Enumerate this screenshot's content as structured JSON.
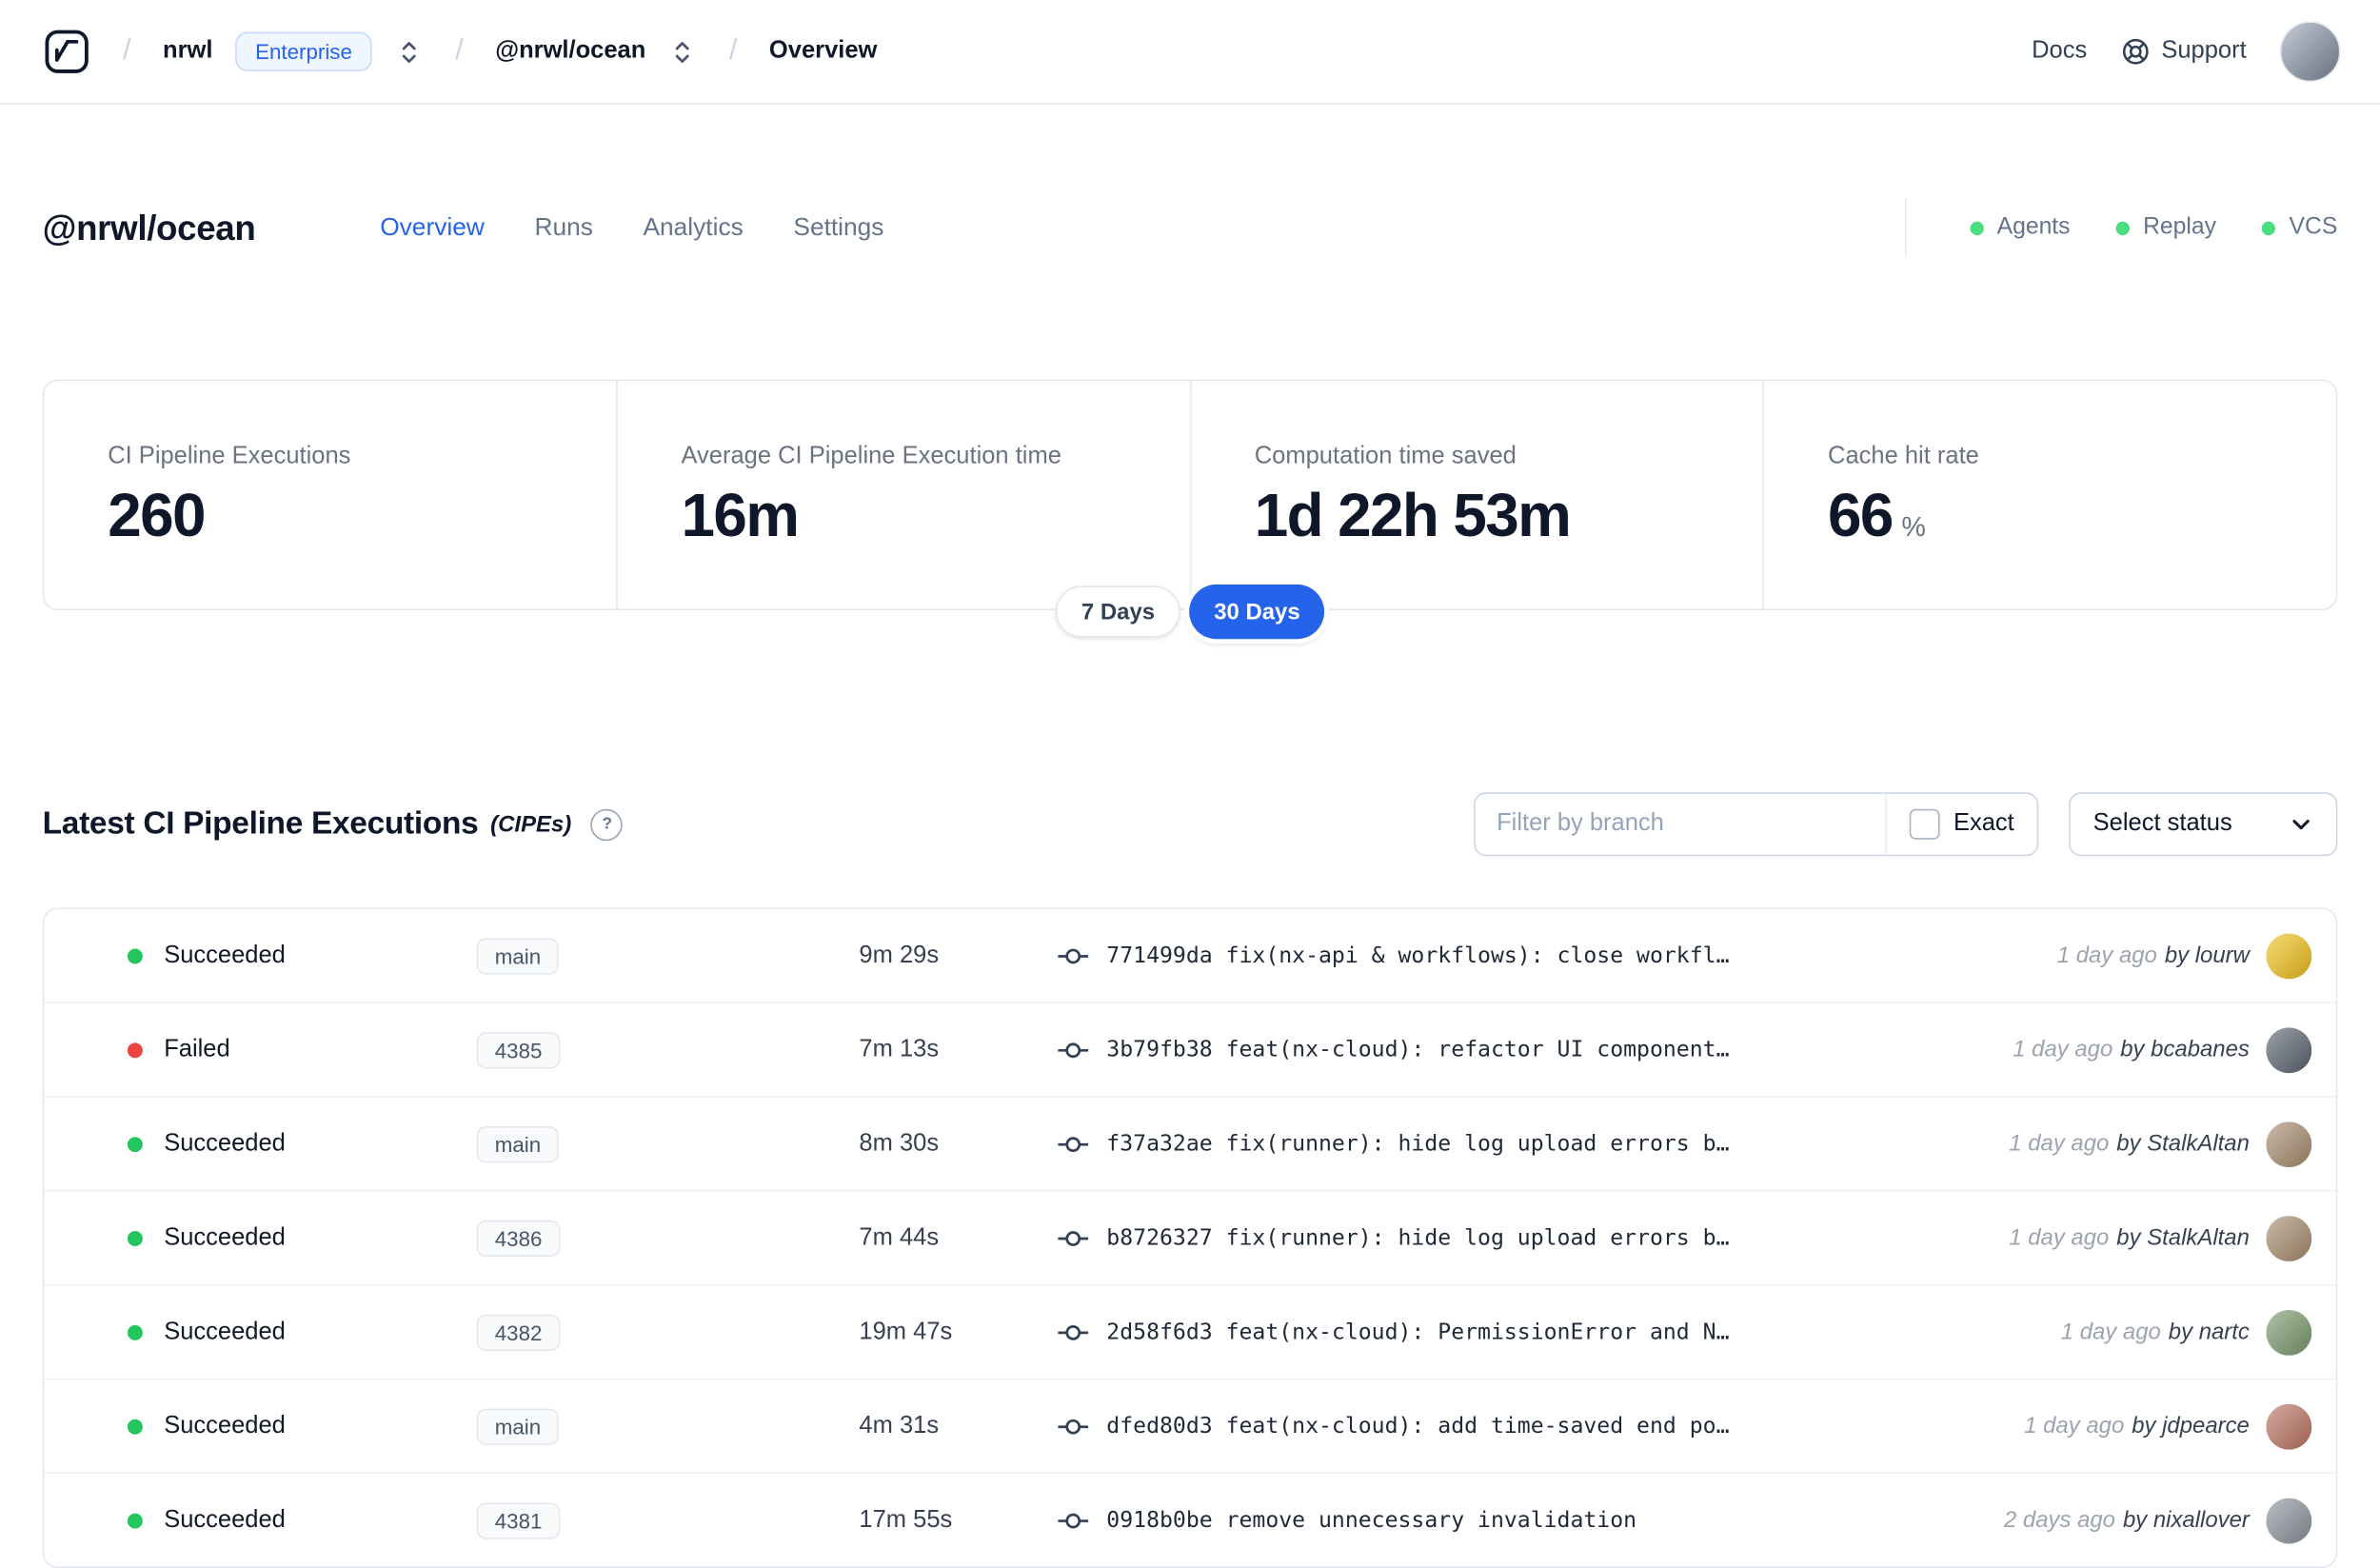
{
  "colors": {
    "accent": "#2563eb",
    "success": "#22c55e",
    "failure": "#ef4444",
    "indicator": "#4ade80"
  },
  "header": {
    "separator": "/",
    "org": "nrwl",
    "org_badge": "Enterprise",
    "workspace": "@nrwl/ocean",
    "page": "Overview",
    "docs": "Docs",
    "support": "Support"
  },
  "workspace_header": {
    "title": "@nrwl/ocean",
    "tabs": [
      {
        "label": "Overview"
      },
      {
        "label": "Runs"
      },
      {
        "label": "Analytics"
      },
      {
        "label": "Settings"
      }
    ],
    "indicators": [
      {
        "label": "Agents"
      },
      {
        "label": "Replay"
      },
      {
        "label": "VCS"
      }
    ]
  },
  "stats": {
    "cards": [
      {
        "label": "CI Pipeline Executions",
        "value": "260"
      },
      {
        "label": "Average CI Pipeline Execution time",
        "value": "16m"
      },
      {
        "label": "Computation time saved",
        "value": "1d 22h 53m"
      },
      {
        "label": "Cache hit rate",
        "value": "66",
        "suffix": "%"
      }
    ],
    "range_toggle": [
      {
        "label": "7 Days"
      },
      {
        "label": "30 Days"
      }
    ],
    "active_range": "30 Days"
  },
  "cipes": {
    "title": "Latest CI Pipeline Executions",
    "title_suffix": "(CIPEs)",
    "help_glyph": "?",
    "filter_placeholder": "Filter by branch",
    "exact_label": "Exact",
    "status_select": "Select status",
    "rows": [
      {
        "status": "Succeeded",
        "color": "green",
        "branch": "main",
        "duration": "9m 29s",
        "commit": "771499da fix(nx-api & workflows): close workfl…",
        "time": "1 day ago",
        "author": "by lourw",
        "avatar_color": "#f2c21b"
      },
      {
        "status": "Failed",
        "color": "red",
        "branch": "4385",
        "duration": "7m 13s",
        "commit": "3b79fb38 feat(nx-cloud): refactor UI component…",
        "time": "1 day ago",
        "author": "by bcabanes",
        "avatar_color": "#5b6472"
      },
      {
        "status": "Succeeded",
        "color": "green",
        "branch": "main",
        "duration": "8m 30s",
        "commit": "f37a32ae fix(runner): hide log upload errors b…",
        "time": "1 day ago",
        "author": "by StalkAltan",
        "avatar_color": "#a98d6f"
      },
      {
        "status": "Succeeded",
        "color": "green",
        "branch": "4386",
        "duration": "7m 44s",
        "commit": "b8726327 fix(runner): hide log upload errors b…",
        "time": "1 day ago",
        "author": "by StalkAltan",
        "avatar_color": "#a98d6f"
      },
      {
        "status": "Succeeded",
        "color": "green",
        "branch": "4382",
        "duration": "19m 47s",
        "commit": "2d58f6d3 feat(nx-cloud): PermissionError and N…",
        "time": "1 day ago",
        "author": "by nartc",
        "avatar_color": "#7c9b6e"
      },
      {
        "status": "Succeeded",
        "color": "green",
        "branch": "main",
        "duration": "4m 31s",
        "commit": "dfed80d3 feat(nx-cloud): add time-saved end po…",
        "time": "1 day ago",
        "author": "by jdpearce",
        "avatar_color": "#bd7463"
      },
      {
        "status": "Succeeded",
        "color": "green",
        "branch": "4381",
        "duration": "17m 55s",
        "commit": "0918b0be remove unnecessary invalidation",
        "time": "2 days ago",
        "author": "by nixallover",
        "avatar_color": "#8e949d"
      }
    ]
  }
}
